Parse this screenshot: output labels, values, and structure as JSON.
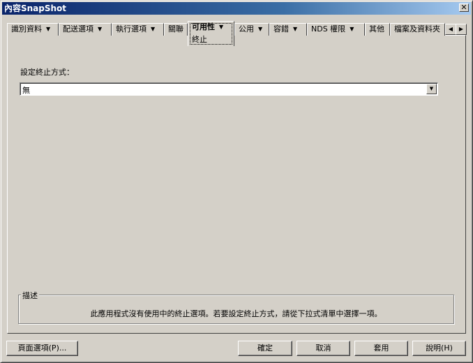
{
  "window": {
    "title": "內容SnapShot",
    "close_glyph": "✕"
  },
  "tabs": [
    {
      "label": "識別資料",
      "dropdown": true
    },
    {
      "label": "配送選項",
      "dropdown": true
    },
    {
      "label": "執行選項",
      "dropdown": true
    },
    {
      "label": "關聯",
      "dropdown": false
    },
    {
      "label": "可用性",
      "dropdown": true,
      "active": true,
      "sublabel": "終止"
    },
    {
      "label": "公用",
      "dropdown": true
    },
    {
      "label": "容錯",
      "dropdown": true
    },
    {
      "label": "NDS 權限",
      "dropdown": true
    },
    {
      "label": "其他",
      "dropdown": false
    },
    {
      "label": "檔案及資料夾",
      "dropdown": false
    }
  ],
  "tab_scroll": {
    "left": "◀",
    "right": "▶"
  },
  "content": {
    "field_label": "設定終止方式：",
    "select_value": "無",
    "select_arrow": "▼"
  },
  "description": {
    "title": "描述",
    "text": "此應用程式沒有使用中的終止選項。若要設定終止方式，請從下拉式清單中選擇一項。"
  },
  "buttons": {
    "page_options": "頁面選項(P)...",
    "ok": "確定",
    "cancel": "取消",
    "apply": "套用",
    "help": "說明(H)"
  },
  "icons": {
    "dropdown_arrow": "▼"
  }
}
